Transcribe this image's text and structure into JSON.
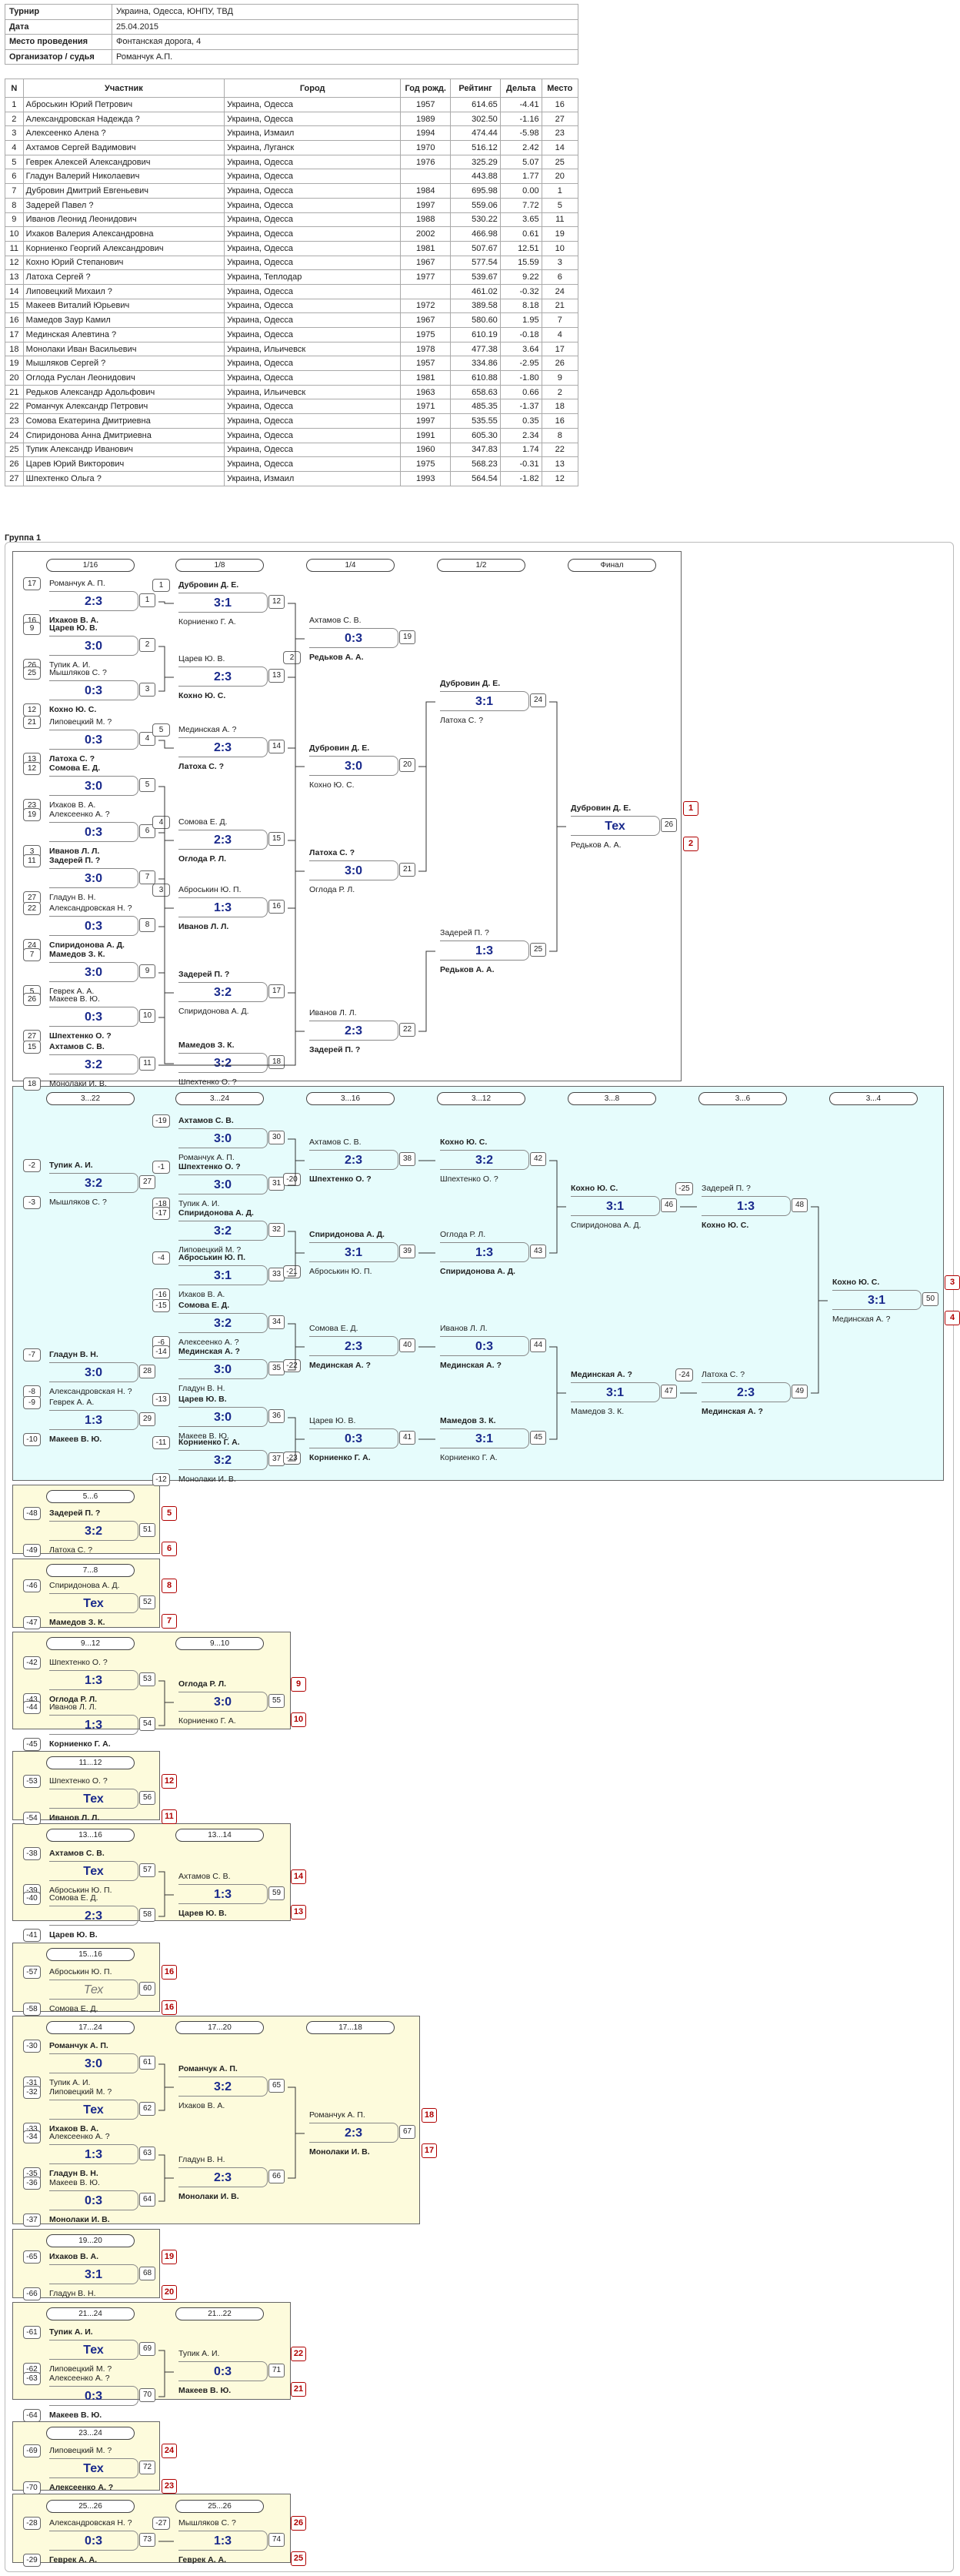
{
  "info": [
    {
      "label": "Турнир",
      "value": "Украина, Одесса, ЮНПУ, ТВД"
    },
    {
      "label": "Дата",
      "value": "25.04.2015"
    },
    {
      "label": "Место проведения",
      "value": "Фонтанская дорога, 4"
    },
    {
      "label": "Организатор / судья",
      "value": "Романчук А.П."
    }
  ],
  "players_header": {
    "n": "N",
    "name": "Участник",
    "city": "Город",
    "born": "Год рожд.",
    "rating": "Рейтинг",
    "delta": "Дельта",
    "place": "Место"
  },
  "players": [
    {
      "n": "1",
      "name": "Аброськин Юрий Петрович",
      "city": "Украина, Одесса",
      "born": "1957",
      "rating": "614.65",
      "delta": "-4.41",
      "place": "16"
    },
    {
      "n": "2",
      "name": "Александровская Надежда ?",
      "city": "Украина, Одесса",
      "born": "1989",
      "rating": "302.50",
      "delta": "-1.16",
      "place": "27"
    },
    {
      "n": "3",
      "name": "Алексеенко Алена ?",
      "city": "Украина, Измаил",
      "born": "1994",
      "rating": "474.44",
      "delta": "-5.98",
      "place": "23"
    },
    {
      "n": "4",
      "name": "Ахтамов Сергей Вадимович",
      "city": "Украина, Луганск",
      "born": "1970",
      "rating": "516.12",
      "delta": "2.42",
      "place": "14"
    },
    {
      "n": "5",
      "name": "Геврек Алексей Александрович",
      "city": "Украина, Одесса",
      "born": "1976",
      "rating": "325.29",
      "delta": "5.07",
      "place": "25"
    },
    {
      "n": "6",
      "name": "Гладун Валерий Николаевич",
      "city": "Украина, Одесса",
      "born": "",
      "rating": "443.88",
      "delta": "1.77",
      "place": "20"
    },
    {
      "n": "7",
      "name": "Дубровин Дмитрий Евгеньевич",
      "city": "Украина, Одесса",
      "born": "1984",
      "rating": "695.98",
      "delta": "0.00",
      "place": "1"
    },
    {
      "n": "8",
      "name": "Задерей Павел ?",
      "city": "Украина, Одесса",
      "born": "1997",
      "rating": "559.06",
      "delta": "7.72",
      "place": "5"
    },
    {
      "n": "9",
      "name": "Иванов Леонид Леонидович",
      "city": "Украина, Одесса",
      "born": "1988",
      "rating": "530.22",
      "delta": "3.65",
      "place": "11"
    },
    {
      "n": "10",
      "name": "Ихаков Валерия Александровна",
      "city": "Украина, Одесса",
      "born": "2002",
      "rating": "466.98",
      "delta": "0.61",
      "place": "19"
    },
    {
      "n": "11",
      "name": "Корниенко Георгий Александрович",
      "city": "Украина, Одесса",
      "born": "1981",
      "rating": "507.67",
      "delta": "12.51",
      "place": "10"
    },
    {
      "n": "12",
      "name": "Кохно Юрий Степанович",
      "city": "Украина, Одесса",
      "born": "1967",
      "rating": "577.54",
      "delta": "15.59",
      "place": "3"
    },
    {
      "n": "13",
      "name": "Латоха Сергей ?",
      "city": "Украина, Теплодар",
      "born": "1977",
      "rating": "539.67",
      "delta": "9.22",
      "place": "6"
    },
    {
      "n": "14",
      "name": "Липовецкий Михаил ?",
      "city": "Украина, Одесса",
      "born": "",
      "rating": "461.02",
      "delta": "-0.32",
      "place": "24"
    },
    {
      "n": "15",
      "name": "Макеев Виталий Юрьевич",
      "city": "Украина, Одесса",
      "born": "1972",
      "rating": "389.58",
      "delta": "8.18",
      "place": "21"
    },
    {
      "n": "16",
      "name": "Мамедов Заур Камил",
      "city": "Украина, Одесса",
      "born": "1967",
      "rating": "580.60",
      "delta": "1.95",
      "place": "7"
    },
    {
      "n": "17",
      "name": "Мединская Алевтина ?",
      "city": "Украина, Одесса",
      "born": "1975",
      "rating": "610.19",
      "delta": "-0.18",
      "place": "4"
    },
    {
      "n": "18",
      "name": "Монолаки Иван Васильевич",
      "city": "Украина, Ильичевск",
      "born": "1978",
      "rating": "477.38",
      "delta": "3.64",
      "place": "17"
    },
    {
      "n": "19",
      "name": "Мышляков Сергей ?",
      "city": "Украина, Одесса",
      "born": "1957",
      "rating": "334.86",
      "delta": "-2.95",
      "place": "26"
    },
    {
      "n": "20",
      "name": "Оглода Руслан Леонидович",
      "city": "Украина, Одесса",
      "born": "1981",
      "rating": "610.88",
      "delta": "-1.80",
      "place": "9"
    },
    {
      "n": "21",
      "name": "Редьков Александр Адольфович",
      "city": "Украина, Ильичевск",
      "born": "1963",
      "rating": "658.63",
      "delta": "0.66",
      "place": "2"
    },
    {
      "n": "22",
      "name": "Романчук Александр Петрович",
      "city": "Украина, Одесса",
      "born": "1971",
      "rating": "485.35",
      "delta": "-1.37",
      "place": "18"
    },
    {
      "n": "23",
      "name": "Сомова Екатерина Дмитриевна",
      "city": "Украина, Одесса",
      "born": "1997",
      "rating": "535.55",
      "delta": "0.35",
      "place": "16"
    },
    {
      "n": "24",
      "name": "Спиридонова Анна Дмитриевна",
      "city": "Украина, Одесса",
      "born": "1991",
      "rating": "605.30",
      "delta": "2.34",
      "place": "8"
    },
    {
      "n": "25",
      "name": "Тупик Александр Иванович",
      "city": "Украина, Одесса",
      "born": "1960",
      "rating": "347.83",
      "delta": "1.74",
      "place": "22"
    },
    {
      "n": "26",
      "name": "Царев Юрий Викторович",
      "city": "Украина, Одесса",
      "born": "1975",
      "rating": "568.23",
      "delta": "-0.31",
      "place": "13"
    },
    {
      "n": "27",
      "name": "Шпехтенко Ольга ?",
      "city": "Украина, Измаил",
      "born": "1993",
      "rating": "564.54",
      "delta": "-1.82",
      "place": "12"
    }
  ],
  "group_title": "Группа 1",
  "main_rounds": [
    "1/16",
    "1/8",
    "1/4",
    "1/2",
    "Финал"
  ],
  "cons_rounds": [
    "3...22",
    "3...24",
    "3...16",
    "3...12",
    "3...8",
    "3...6",
    "3...4"
  ],
  "side_headers": [
    "5...6",
    "7...8",
    "9...12",
    "9...10",
    "11...12",
    "13...16",
    "13...14",
    "15...16",
    "17...24",
    "17...20",
    "17...18",
    "19...20",
    "21...24",
    "21...22",
    "23...24",
    "25...26",
    "25...26"
  ],
  "tex": "Тех",
  "matches": [
    {
      "id": "1",
      "a": "Романчук А. П.",
      "b": "Ихаков В. А.",
      "s": "2:3",
      "w": "b"
    },
    {
      "id": "2",
      "a": "Царев Ю. В.",
      "b": "Тупик А. И.",
      "s": "3:0",
      "w": "a"
    },
    {
      "id": "3",
      "a": "Мышляков С. ?",
      "b": "Кохно Ю. С.",
      "s": "0:3",
      "w": "b"
    },
    {
      "id": "4",
      "a": "Липовецкий М. ?",
      "b": "Латоха С. ?",
      "s": "0:3",
      "w": "b"
    },
    {
      "id": "5",
      "a": "Сомова Е. Д.",
      "b": "Ихаков В. А.",
      "s": "3:0",
      "w": "a"
    },
    {
      "id": "6",
      "a": "Алексеенко А. ?",
      "b": "Иванов Л. Л.",
      "s": "0:3",
      "w": "b"
    },
    {
      "id": "7",
      "a": "Задерей П. ?",
      "b": "Гладун В. Н.",
      "s": "3:0",
      "w": "a"
    },
    {
      "id": "8",
      "a": "Александровская Н. ?",
      "b": "Спиридонова А. Д.",
      "s": "0:3",
      "w": "b"
    },
    {
      "id": "9",
      "a": "Мамедов З. К.",
      "b": "Геврек А. А.",
      "s": "3:0",
      "w": "a"
    },
    {
      "id": "10",
      "a": "Макеев В. Ю.",
      "b": "Шпехтенко О. ?",
      "s": "0:3",
      "w": "b"
    },
    {
      "id": "11",
      "a": "Ахтамов С. В.",
      "b": "Монолаки И. В.",
      "s": "3:2",
      "w": "a"
    },
    {
      "id": "12",
      "a": "Дубровин Д. Е.",
      "b": "Корниенко Г. А.",
      "s": "3:1",
      "w": "a"
    },
    {
      "id": "13",
      "a": "Царев Ю. В.",
      "b": "Кохно Ю. С.",
      "s": "2:3",
      "w": "b"
    },
    {
      "id": "14",
      "a": "Мединская А. ?",
      "b": "Латоха С. ?",
      "s": "2:3",
      "w": "b"
    },
    {
      "id": "15",
      "a": "Сомова Е. Д.",
      "b": "Оглода Р. Л.",
      "s": "2:3",
      "w": "b"
    },
    {
      "id": "16",
      "a": "Аброськин Ю. П.",
      "b": "Иванов Л. Л.",
      "s": "1:3",
      "w": "b"
    },
    {
      "id": "17",
      "a": "Задерей П. ?",
      "b": "Спиридонова А. Д.",
      "s": "3:2",
      "w": "a"
    },
    {
      "id": "18",
      "a": "Мамедов З. К.",
      "b": "Шпехтенко О. ?",
      "s": "3:2",
      "w": "a"
    },
    {
      "id": "19",
      "a": "Ахтамов С. В.",
      "b": "Редьков А. А.",
      "s": "0:3",
      "w": "b"
    },
    {
      "id": "20",
      "a": "Дубровин Д. Е.",
      "b": "Кохно Ю. С.",
      "s": "3:0",
      "w": "a"
    },
    {
      "id": "21",
      "a": "Латоха С. ?",
      "b": "Оглода Р. Л.",
      "s": "3:0",
      "w": "a"
    },
    {
      "id": "22",
      "a": "Иванов Л. Л.",
      "b": "Задерей П. ?",
      "s": "2:3",
      "w": "b"
    },
    {
      "id": "23",
      "a": "Мамедов З. К.",
      "b": "Редьков А. А.",
      "s": "0:3",
      "w": "b"
    },
    {
      "id": "24",
      "a": "Дубровин Д. Е.",
      "b": "Латоха С. ?",
      "s": "3:1",
      "w": "a"
    },
    {
      "id": "25",
      "a": "Задерей П. ?",
      "b": "Редьков А. А.",
      "s": "1:3",
      "w": "b"
    },
    {
      "id": "26",
      "a": "Дубровин Д. Е.",
      "b": "Редьков А. А.",
      "s": "Тех",
      "w": "a"
    },
    {
      "id": "27",
      "a": "Тупик А. И.",
      "b": "Мышляков С. ?",
      "s": "3:2",
      "w": "a"
    },
    {
      "id": "28",
      "a": "Гладун В. Н.",
      "b": "Александровская Н. ?",
      "s": "3:0",
      "w": "a"
    },
    {
      "id": "29",
      "a": "Геврек А. А.",
      "b": "Макеев В. Ю.",
      "s": "1:3",
      "w": "b"
    },
    {
      "id": "30",
      "a": "Ахтамов С. В.",
      "b": "Романчук А. П.",
      "s": "3:0",
      "w": "a"
    },
    {
      "id": "31",
      "a": "Шпехтенко О. ?",
      "b": "Тупик А. И.",
      "s": "3:0",
      "w": "a"
    },
    {
      "id": "32",
      "a": "Спиридонова А. Д.",
      "b": "Липовецкий М. ?",
      "s": "3:2",
      "w": "a"
    },
    {
      "id": "33",
      "a": "Аброськин Ю. П.",
      "b": "Ихаков В. А.",
      "s": "3:1",
      "w": "a"
    },
    {
      "id": "34",
      "a": "Сомова Е. Д.",
      "b": "Алексеенко А. ?",
      "s": "3:2",
      "w": "a"
    },
    {
      "id": "35",
      "a": "Мединская А. ?",
      "b": "Гладун В. Н.",
      "s": "3:0",
      "w": "a"
    },
    {
      "id": "36",
      "a": "Царев Ю. В.",
      "b": "Макеев В. Ю.",
      "s": "3:0",
      "w": "a"
    },
    {
      "id": "37",
      "a": "Корниенко Г. А.",
      "b": "Монолаки И. В.",
      "s": "3:2",
      "w": "a"
    },
    {
      "id": "38",
      "a": "Ахтамов С. В.",
      "b": "Шпехтенко О. ?",
      "s": "2:3",
      "w": "b"
    },
    {
      "id": "39",
      "a": "Спиридонова А. Д.",
      "b": "Аброськин Ю. П.",
      "s": "3:1",
      "w": "a"
    },
    {
      "id": "40",
      "a": "Сомова Е. Д.",
      "b": "Мединская А. ?",
      "s": "2:3",
      "w": "b"
    },
    {
      "id": "41",
      "a": "Царев Ю. В.",
      "b": "Корниенко Г. А.",
      "s": "0:3",
      "w": "b"
    },
    {
      "id": "42",
      "a": "Кохно Ю. С.",
      "b": "Шпехтенко О. ?",
      "s": "3:2",
      "w": "a"
    },
    {
      "id": "43",
      "a": "Оглода Р. Л.",
      "b": "Спиридонова А. Д.",
      "s": "1:3",
      "w": "b"
    },
    {
      "id": "44",
      "a": "Иванов Л. Л.",
      "b": "Мединская А. ?",
      "s": "0:3",
      "w": "b"
    },
    {
      "id": "45",
      "a": "Мамедов З. К.",
      "b": "Корниенко Г. А.",
      "s": "3:1",
      "w": "a"
    },
    {
      "id": "46",
      "a": "Кохно Ю. С.",
      "b": "Спиридонова А. Д.",
      "s": "3:1",
      "w": "a"
    },
    {
      "id": "47",
      "a": "Мединская А. ?",
      "b": "Мамедов З. К.",
      "s": "3:1",
      "w": "a"
    },
    {
      "id": "48",
      "a": "Задерей П. ?",
      "b": "Кохно Ю. С.",
      "s": "1:3",
      "w": "b"
    },
    {
      "id": "49",
      "a": "Латоха С. ?",
      "b": "Мединская А. ?",
      "s": "2:3",
      "w": "b"
    },
    {
      "id": "50",
      "a": "Кохно Ю. С.",
      "b": "Мединская А. ?",
      "s": "3:1",
      "w": "a"
    },
    {
      "id": "51",
      "a": "Задерей П. ?",
      "b": "Латоха С. ?",
      "s": "3:2",
      "w": "a"
    },
    {
      "id": "52",
      "a": "Спиридонова А. Д.",
      "b": "Мамедов З. К.",
      "s": "Тех",
      "w": "b"
    },
    {
      "id": "53",
      "a": "Шпехтенко О. ?",
      "b": "Оглода Р. Л.",
      "s": "1:3",
      "w": "b"
    },
    {
      "id": "54",
      "a": "Иванов Л. Л.",
      "b": "Корниенко Г. А.",
      "s": "1:3",
      "w": "b"
    },
    {
      "id": "55",
      "a": "Оглода Р. Л.",
      "b": "Корниенко Г. А.",
      "s": "3:0",
      "w": "a"
    },
    {
      "id": "56",
      "a": "Шпехтенко О. ?",
      "b": "Иванов Л. Л.",
      "s": "Тех",
      "w": "b"
    },
    {
      "id": "57",
      "a": "Ахтамов С. В.",
      "b": "Аброськин Ю. П.",
      "s": "Тех",
      "w": "a"
    },
    {
      "id": "58",
      "a": "Сомова Е. Д.",
      "b": "Царев Ю. В.",
      "s": "2:3",
      "w": "b"
    },
    {
      "id": "59",
      "a": "Ахтамов С. В.",
      "b": "Царев Ю. В.",
      "s": "1:3",
      "w": "b"
    },
    {
      "id": "60",
      "a": "Аброськин Ю. П.",
      "b": "Сомова Е. Д.",
      "s": "Тех",
      "w": ""
    },
    {
      "id": "61",
      "a": "Романчук А. П.",
      "b": "Тупик А. И.",
      "s": "3:0",
      "w": "a"
    },
    {
      "id": "62",
      "a": "Липовецкий М. ?",
      "b": "Ихаков В. А.",
      "s": "Тех",
      "w": "b"
    },
    {
      "id": "63",
      "a": "Алексеенко А. ?",
      "b": "Гладун В. Н.",
      "s": "1:3",
      "w": "b"
    },
    {
      "id": "64",
      "a": "Макеев В. Ю.",
      "b": "Монолаки И. В.",
      "s": "0:3",
      "w": "b"
    },
    {
      "id": "65",
      "a": "Романчук А. П.",
      "b": "Ихаков В. А.",
      "s": "3:2",
      "w": "a"
    },
    {
      "id": "66",
      "a": "Гладун В. Н.",
      "b": "Монолаки И. В.",
      "s": "2:3",
      "w": "b"
    },
    {
      "id": "67",
      "a": "Романчук А. П.",
      "b": "Монолаки И. В.",
      "s": "2:3",
      "w": "b"
    },
    {
      "id": "68",
      "a": "Ихаков В. А.",
      "b": "Гладун В. Н.",
      "s": "3:1",
      "w": "a"
    },
    {
      "id": "69",
      "a": "Тупик А. И.",
      "b": "Липовецкий М. ?",
      "s": "Тех",
      "w": "a"
    },
    {
      "id": "70",
      "a": "Алексеенко А. ?",
      "b": "Макеев В. Ю.",
      "s": "0:3",
      "w": "b"
    },
    {
      "id": "71",
      "a": "Тупик А. И.",
      "b": "Макеев В. Ю.",
      "s": "0:3",
      "w": "b"
    },
    {
      "id": "72",
      "a": "Липовецкий М. ?",
      "b": "Алексеенко А. ?",
      "s": "Тех",
      "w": "b"
    },
    {
      "id": "73",
      "a": "Александровская Н. ?",
      "b": "Геврек А. А.",
      "s": "0:3",
      "w": "b"
    },
    {
      "id": "74",
      "a": "Мышляков С. ?",
      "b": "Геврек А. А.",
      "s": "1:3",
      "w": "b"
    }
  ],
  "seeds": {
    "1": [
      "17",
      "16"
    ],
    "2": [
      "9",
      "26"
    ],
    "3": [
      "25",
      "12"
    ],
    "4": [
      "21",
      "13"
    ],
    "5": [
      "12",
      "23"
    ],
    "6": [
      "19",
      "3"
    ],
    "7": [
      "11",
      "27"
    ],
    "8": [
      "22",
      "24"
    ],
    "9": [
      "7",
      "5"
    ],
    "10": [
      "26",
      "27"
    ],
    "11": [
      "15",
      "18"
    ],
    "12": [
      "1",
      ""
    ],
    "14": [
      "5",
      ""
    ],
    "15": [
      "4",
      ""
    ],
    "16": [
      "3",
      ""
    ],
    "19": [
      "",
      "2"
    ],
    "27": [
      "-2",
      "-3"
    ],
    "28": [
      "-7",
      "-8"
    ],
    "29": [
      "-9",
      "-10"
    ],
    "30": [
      "-19",
      ""
    ],
    "31": [
      "-1",
      "-18"
    ],
    "32": [
      "-17",
      ""
    ],
    "33": [
      "-4",
      "-16"
    ],
    "34": [
      "-15",
      "-6"
    ],
    "35": [
      "-14",
      ""
    ],
    "36": [
      "-13",
      ""
    ],
    "37": [
      "-11",
      "-12"
    ],
    "38": [
      "",
      "-20"
    ],
    "39": [
      "",
      "-21"
    ],
    "40": [
      "",
      "-22"
    ],
    "41": [
      "",
      "-23"
    ],
    "48": [
      "-25",
      ""
    ],
    "49": [
      "-24",
      ""
    ],
    "51": [
      "-48",
      "-49"
    ],
    "52": [
      "-46",
      "-47"
    ],
    "53": [
      "-42",
      "-43"
    ],
    "54": [
      "-44",
      "-45"
    ],
    "56": [
      "-53",
      "-54"
    ],
    "57": [
      "-38",
      "-39"
    ],
    "58": [
      "-40",
      "-41"
    ],
    "60": [
      "-57",
      "-58"
    ],
    "61": [
      "-30",
      "-31"
    ],
    "62": [
      "-32",
      "-33"
    ],
    "63": [
      "-34",
      "-35"
    ],
    "64": [
      "-36",
      "-37"
    ],
    "68": [
      "-65",
      "-66"
    ],
    "69": [
      "-61",
      "-62"
    ],
    "70": [
      "-63",
      "-64"
    ],
    "72": [
      "-69",
      "-70"
    ],
    "73": [
      "-28",
      "-29"
    ],
    "74": [
      "-27",
      ""
    ]
  },
  "places": {
    "26": [
      "1",
      "2"
    ],
    "50": [
      "3",
      "4"
    ],
    "51": [
      "5",
      "6"
    ],
    "52": [
      "8",
      "7"
    ],
    "55": [
      "9",
      "10"
    ],
    "56": [
      "12",
      "11"
    ],
    "59": [
      "14",
      "13"
    ],
    "60": [
      "16",
      "16"
    ],
    "67": [
      "18",
      "17"
    ],
    "68": [
      "19",
      "20"
    ],
    "71": [
      "22",
      "21"
    ],
    "72": [
      "24",
      "23"
    ],
    "74": [
      "26",
      "25"
    ]
  },
  "colors": {
    "score": "#1a2a8c",
    "cons_bg": "#e6fcfc",
    "side_bg": "#fdfbdc",
    "place": "#b00000",
    "tech": "#777777"
  }
}
